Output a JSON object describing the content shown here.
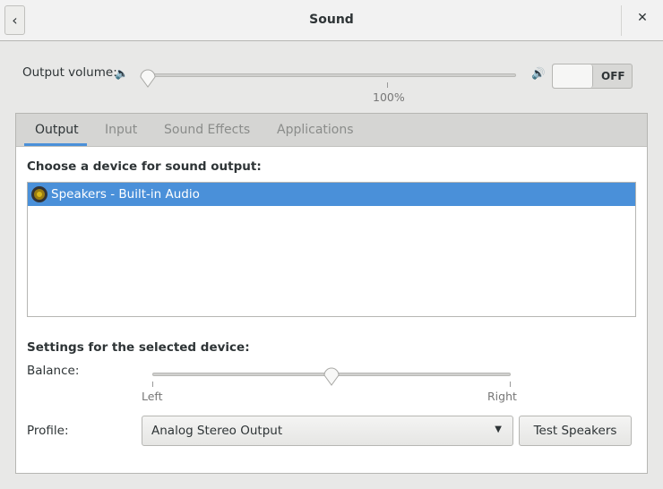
{
  "header": {
    "title": "Sound",
    "back_icon": "chevron-left",
    "close_icon": "close"
  },
  "volume": {
    "label": "Output volume:",
    "value_percent": 0,
    "mark_label": "100%",
    "mute_toggle": "OFF"
  },
  "tabs": [
    {
      "label": "Output",
      "active": true
    },
    {
      "label": "Input"
    },
    {
      "label": "Sound Effects"
    },
    {
      "label": "Applications"
    }
  ],
  "output": {
    "choose_label": "Choose a device for sound output:",
    "devices": [
      {
        "name": "Speakers - Built-in Audio",
        "selected": true
      }
    ],
    "settings_label": "Settings for the selected device:",
    "balance": {
      "label": "Balance:",
      "left": "Left",
      "right": "Right",
      "value": 0
    },
    "profile": {
      "label": "Profile:",
      "value": "Analog Stereo Output"
    },
    "test_button": "Test Speakers"
  },
  "colors": {
    "accent": "#4a90d9"
  }
}
